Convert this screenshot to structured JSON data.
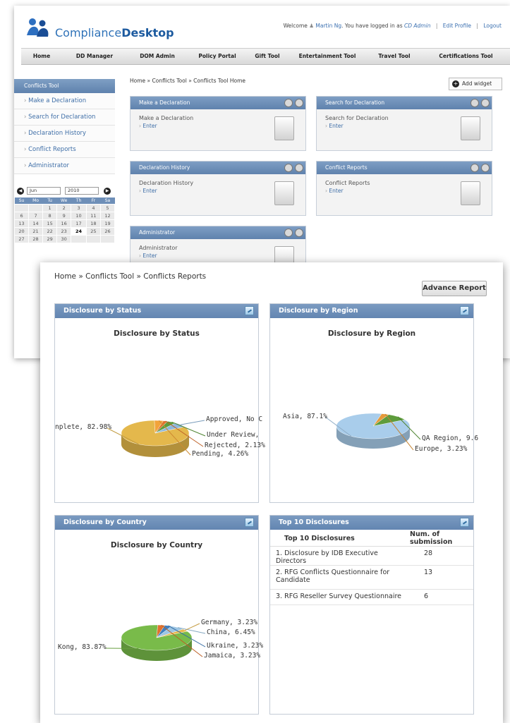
{
  "back": {
    "logo": {
      "text_plain": "Compliance",
      "text_bold": "Desktop"
    },
    "welcome": {
      "prefix": "Welcome",
      "user": "Martin Ng",
      "middle": ". You have logged in as",
      "role": "CD Admin",
      "edit_profile": "Edit Profile",
      "logout": "Logout"
    },
    "nav": [
      "Home",
      "DD Manager",
      "DOM Admin",
      "Policy Portal",
      "Gift Tool",
      "Entertainment Tool",
      "Travel Tool",
      "Certifications Tool"
    ],
    "sidebar": {
      "title": "Conflicts Tool",
      "items": [
        "Make a Declaration",
        "Search for Declaration",
        "Declaration History",
        "Conflict Reports",
        "Administrator"
      ]
    },
    "calendar": {
      "month": "Jun",
      "year": "2010",
      "days": [
        "Su",
        "Mo",
        "Tu",
        "We",
        "Th",
        "Fr",
        "Sa"
      ],
      "weeks": [
        [
          "",
          "",
          "1",
          "2",
          "3",
          "4",
          "5"
        ],
        [
          "6",
          "7",
          "8",
          "9",
          "10",
          "11",
          "12"
        ],
        [
          "13",
          "14",
          "15",
          "16",
          "17",
          "18",
          "19"
        ],
        [
          "20",
          "21",
          "22",
          "23",
          "24",
          "25",
          "26"
        ],
        [
          "27",
          "28",
          "29",
          "30",
          "",
          "",
          ""
        ]
      ],
      "today": "24"
    },
    "breadcrumb": "Home » Conflicts Tool » Conflicts Tool Home",
    "add_widget": "Add widget",
    "widgets": [
      {
        "title": "Make a Declaration",
        "body": "Make a Declaration",
        "enter": "Enter"
      },
      {
        "title": "Search for Declaration",
        "body": "Search for Declaration",
        "enter": "Enter"
      },
      {
        "title": "Declaration History",
        "body": "Declaration History",
        "enter": "Enter"
      },
      {
        "title": "Conflict Reports",
        "body": "Conflict Reports",
        "enter": "Enter"
      },
      {
        "title": "Administrator",
        "body": "Administrator",
        "enter": "Enter"
      }
    ]
  },
  "front": {
    "breadcrumb": "Home » Conflicts Tool » Conflicts Reports",
    "advance_report": "Advance Report",
    "panels": {
      "status": {
        "header": "Disclosure by Status",
        "title": "Disclosure by Status"
      },
      "region": {
        "header": "Disclosure by Region",
        "title": "Disclosure by Region"
      },
      "country": {
        "header": "Disclosure by Country",
        "title": "Disclosure by Country"
      },
      "top10": {
        "header": "Top 10 Disclosures",
        "col1": "Top 10 Disclosures",
        "col2": "Num. of submission",
        "rows": [
          {
            "rank": "1.",
            "name": "Disclosure by IDB Executive Directors",
            "count": "28"
          },
          {
            "rank": "2.",
            "name": "RFG Conflicts Questionnaire for Candidate",
            "count": "13"
          },
          {
            "rank": "3.",
            "name": "RFG Reseller Survey Questionnaire",
            "count": "6"
          }
        ]
      }
    }
  },
  "chart_data": [
    {
      "type": "pie",
      "title": "Disclosure by Status",
      "series": [
        {
          "values": [
            82.98,
            4.26,
            2.13,
            4.26,
            6.38
          ]
        }
      ],
      "labels": [
        "nplete, 82.98%",
        "Pending, 4.26%",
        "Rejected, 2.13%",
        "Under Review,",
        "Approved, No C"
      ],
      "colors": [
        "#e4b84c",
        "#f2a33a",
        "#e0722e",
        "#5e9c3c",
        "#8fb8dc"
      ]
    },
    {
      "type": "pie",
      "title": "Disclosure by Region",
      "series": [
        {
          "values": [
            87.1,
            3.23,
            9.67
          ]
        }
      ],
      "labels": [
        "Asia, 87.1%",
        "Europe, 3.23%",
        "QA Region, 9.6"
      ],
      "colors": [
        "#a9cdeb",
        "#e69a3a",
        "#5e9c3c"
      ]
    },
    {
      "type": "pie",
      "title": "Disclosure by Country",
      "series": [
        {
          "values": [
            83.87,
            3.23,
            3.23,
            6.45,
            3.23
          ]
        }
      ],
      "labels": [
        "Kong, 83.87%",
        "Jamaica, 3.23%",
        "Ukraine, 3.23%",
        "China, 6.45%",
        "Germany, 3.23%"
      ],
      "colors": [
        "#79bb4a",
        "#e0722e",
        "#3f7fc0",
        "#9ec6e4",
        "#e8b84e"
      ]
    }
  ]
}
